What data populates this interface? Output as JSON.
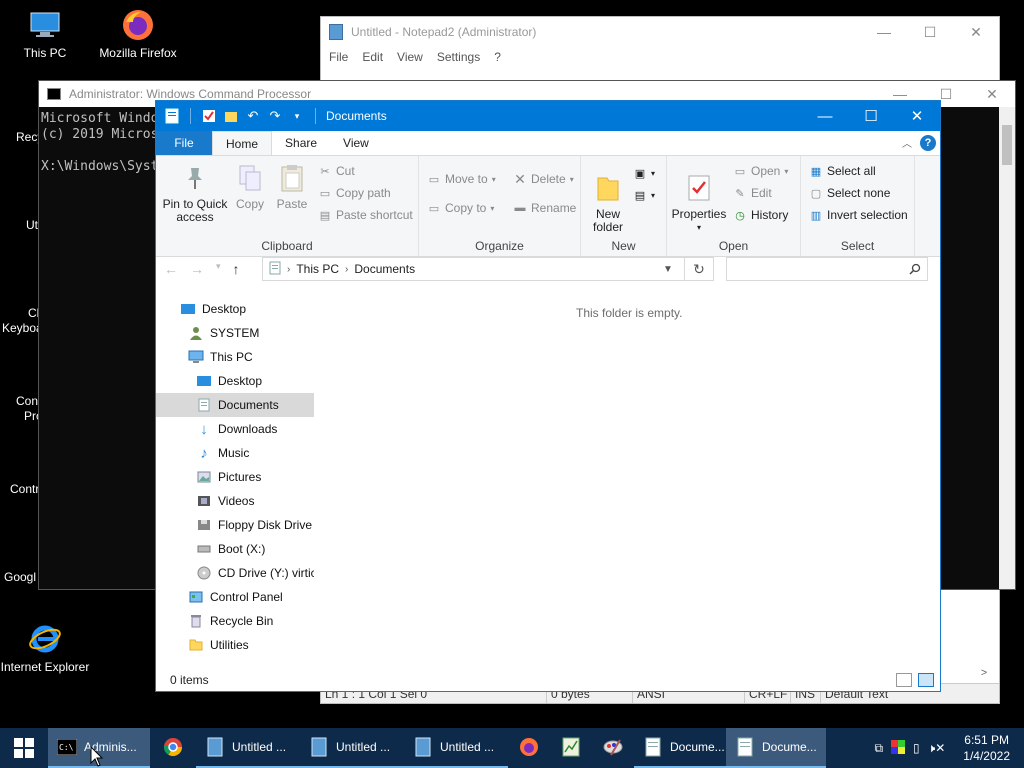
{
  "desktop": {
    "icons": [
      {
        "label": "This PC"
      },
      {
        "label": "Mozilla Firefox"
      },
      {
        "label": "Internet Explorer"
      }
    ],
    "partials": [
      "Recy",
      "Uti",
      "Ch",
      "Keyboa",
      "Con",
      "Pro",
      "Contr",
      "Googl"
    ]
  },
  "notepad": {
    "title": "Untitled - Notepad2 (Administrator)",
    "menu": [
      "File",
      "Edit",
      "View",
      "Settings",
      "?"
    ],
    "status": [
      "Ln 1 : 1   Col 1   Sel 0",
      "0 bytes",
      "ANSI",
      "CR+LF",
      "INS",
      "Default Text"
    ]
  },
  "cmd": {
    "title": "Administrator: Windows Command Processor",
    "lines": [
      "Microsoft Windo",
      "(c) 2019 Micros",
      "",
      "X:\\Windows\\Syst"
    ]
  },
  "explorer": {
    "title": "Documents",
    "tabs": {
      "file": "File",
      "home": "Home",
      "share": "Share",
      "view": "View"
    },
    "ribbon": {
      "pin": "Pin to Quick access",
      "copy": "Copy",
      "paste": "Paste",
      "cut": "Cut",
      "copy_path": "Copy path",
      "paste_shortcut": "Paste shortcut",
      "clipboard_label": "Clipboard",
      "move_to": "Move to",
      "delete": "Delete",
      "copy_to": "Copy to",
      "rename": "Rename",
      "organize_label": "Organize",
      "new_folder": "New folder",
      "new_label": "New",
      "properties": "Properties",
      "open": "Open",
      "edit": "Edit",
      "history": "History",
      "open_label": "Open",
      "select_all": "Select all",
      "select_none": "Select none",
      "invert_selection": "Invert selection",
      "select_label": "Select"
    },
    "breadcrumb": [
      "This PC",
      "Documents"
    ],
    "search_placeholder": "",
    "nav": [
      {
        "label": "Desktop"
      },
      {
        "label": "SYSTEM"
      },
      {
        "label": "This PC"
      },
      {
        "label": "Desktop"
      },
      {
        "label": "Documents"
      },
      {
        "label": "Downloads"
      },
      {
        "label": "Music"
      },
      {
        "label": "Pictures"
      },
      {
        "label": "Videos"
      },
      {
        "label": "Floppy Disk Drive"
      },
      {
        "label": "Boot (X:)"
      },
      {
        "label": "CD Drive (Y:) virtic"
      },
      {
        "label": "Control Panel"
      },
      {
        "label": "Recycle Bin"
      },
      {
        "label": "Utilities"
      }
    ],
    "empty_message": "This folder is empty.",
    "status": "0 items"
  },
  "taskbar": {
    "items": [
      {
        "label": "Adminis..."
      },
      {
        "label": ""
      },
      {
        "label": "Untitled ..."
      },
      {
        "label": "Untitled ..."
      },
      {
        "label": "Untitled ..."
      },
      {
        "label": ""
      },
      {
        "label": ""
      },
      {
        "label": ""
      },
      {
        "label": "Docume..."
      },
      {
        "label": "Docume..."
      }
    ],
    "time": "6:51 PM",
    "date": "1/4/2022"
  },
  "colors": {
    "title_blue": "#0078d7",
    "taskbar": "#0d2a4a"
  }
}
